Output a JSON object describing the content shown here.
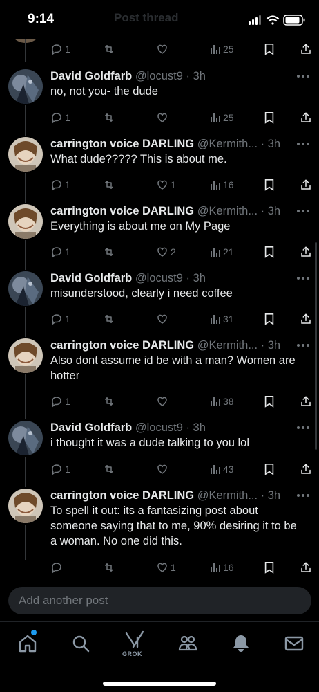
{
  "status_bar": {
    "time": "9:14",
    "ghost_title": "Post thread"
  },
  "colors": {
    "background": "#000000",
    "text": "#e7e9ea",
    "muted": "#71767b",
    "accent": "#1d9bf0",
    "divider": "#333639"
  },
  "top_actions": {
    "replies": "1",
    "views": "25"
  },
  "tweets": [
    {
      "name": "David Goldfarb",
      "handle": "@locust9 · 3h",
      "text": "no, not you- the dude",
      "replies": "1",
      "likes": "",
      "views": "25",
      "avatar": "david"
    },
    {
      "name": "carrington voice DARLING",
      "handle": "@Kermith... · 3h",
      "text": "What dude????? This is about me.",
      "replies": "1",
      "likes": "1",
      "views": "16",
      "avatar": "carrington"
    },
    {
      "name": "carrington voice DARLING",
      "handle": "@Kermith... · 3h",
      "text": "Everything is about me on My Page",
      "replies": "1",
      "likes": "2",
      "views": "21",
      "avatar": "carrington"
    },
    {
      "name": "David Goldfarb",
      "handle": "@locust9 · 3h",
      "text": "misunderstood, clearly i need coffee",
      "replies": "1",
      "likes": "",
      "views": "31",
      "avatar": "david"
    },
    {
      "name": "carrington voice DARLING",
      "handle": "@Kermith... · 3h",
      "text": "Also dont assume id be with a man? Women are hotter",
      "replies": "1",
      "likes": "",
      "views": "38",
      "avatar": "carrington"
    },
    {
      "name": "David Goldfarb",
      "handle": "@locust9 · 3h",
      "text": "i thought it was a dude talking to you lol",
      "replies": "1",
      "likes": "",
      "views": "43",
      "avatar": "david"
    },
    {
      "name": "carrington voice DARLING",
      "handle": "@Kermith... · 3h",
      "text": "To spell it out: its a fantasizing post about someone saying that to me, 90% desiring it to be a woman. No one did this.",
      "replies": "",
      "likes": "1",
      "views": "16",
      "avatar": "carrington"
    }
  ],
  "composer": {
    "placeholder": "Add another post"
  },
  "tabbar": {
    "grok_label": "GROK",
    "items": [
      "home-icon",
      "search-icon",
      "grok-icon",
      "communities-icon",
      "notifications-icon",
      "messages-icon"
    ]
  }
}
